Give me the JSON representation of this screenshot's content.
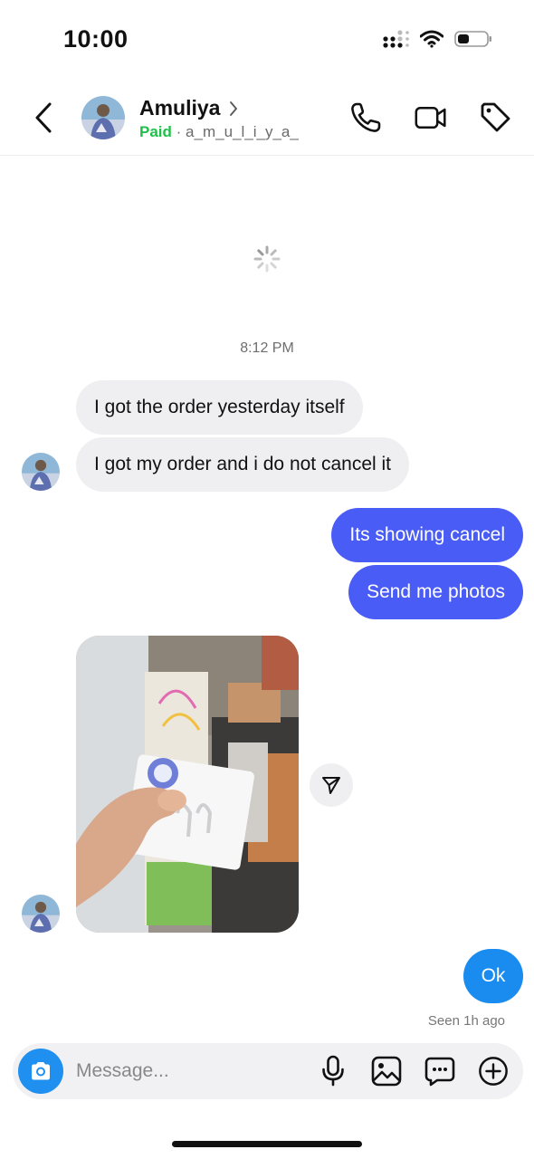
{
  "status_bar": {
    "time": "10:00"
  },
  "header": {
    "name": "Amuliya",
    "paid_label": "Paid",
    "separator": "·",
    "username": "a_m_u_l_i_y_a_"
  },
  "conversation": {
    "timestamp": "8:12 PM",
    "incoming": [
      "I got the order yesterday itself",
      "I got my order and i do not cancel it"
    ],
    "outgoing": [
      "Its showing cancel",
      "Send me photos"
    ],
    "reply": "Ok",
    "seen_status": "Seen 1h ago"
  },
  "composer": {
    "placeholder": "Message..."
  },
  "colors": {
    "outgoing_bubble": "#4a5cf6",
    "reply_bubble": "#1a8cf0",
    "incoming_bubble": "#efeff1",
    "paid_green": "#1fbf4a",
    "camera_button": "#1f8ff0"
  },
  "icons": {
    "header": [
      "back-chevron-icon",
      "phone-icon",
      "video-camera-icon",
      "tag-icon"
    ],
    "composer": [
      "camera-icon",
      "microphone-icon",
      "gallery-icon",
      "sticker-chat-icon",
      "plus-circle-icon"
    ],
    "photo": [
      "share-send-icon"
    ]
  }
}
